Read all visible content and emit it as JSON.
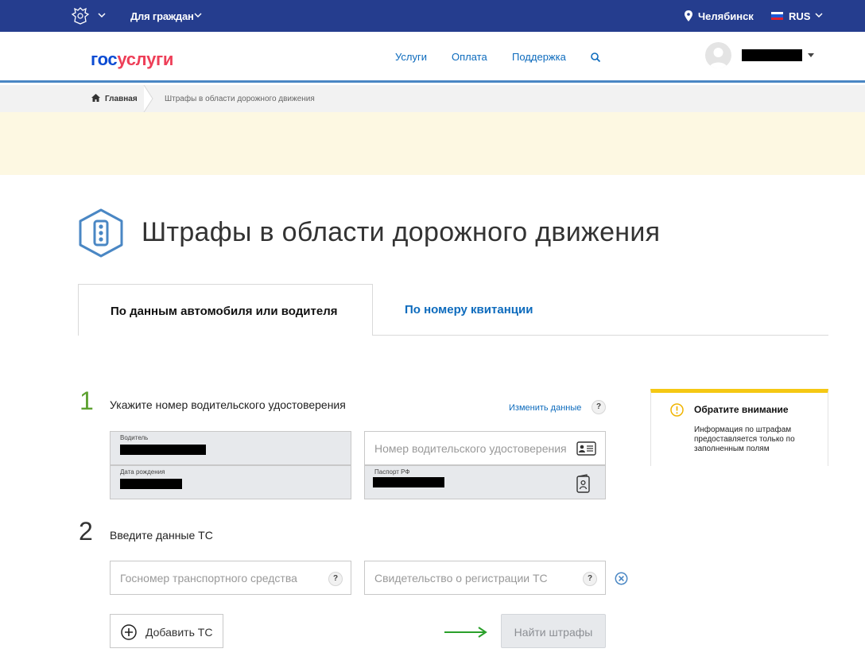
{
  "topbar": {
    "audience": "Для граждан",
    "city": "Челябинск",
    "language": "RUS"
  },
  "header": {
    "logo_part1": "гос",
    "logo_part2": "услуги",
    "nav": [
      "Услуги",
      "Оплата",
      "Поддержка"
    ]
  },
  "breadcrumb": {
    "home": "Главная",
    "current": "Штрафы в области дорожного движения"
  },
  "page": {
    "title": "Штрафы в области дорожного движения"
  },
  "tabs": [
    {
      "label": "По данным автомобиля или водителя",
      "active": true
    },
    {
      "label": "По номеру квитанции",
      "active": false
    }
  ],
  "step1": {
    "number": "1",
    "label": "Укажите номер водительского удостоверения",
    "change_link": "Изменить данные",
    "help": "?",
    "driver_caption": "Водитель",
    "birthdate_caption": "Дата рождения",
    "license_placeholder": "Номер водительского удостоверения",
    "passport_caption": "Паспорт РФ"
  },
  "step2": {
    "number": "2",
    "label": "Введите данные ТС",
    "plate_placeholder": "Госномер транспортного средства",
    "registration_placeholder": "Свидетельство о регистрации ТС",
    "help": "?"
  },
  "notice": {
    "title": "Обратите внимание",
    "text": "Информация по штрафам предоставляется только по заполненным полям"
  },
  "buttons": {
    "add_vehicle": "Добавить ТС",
    "find_fines": "Найти штрафы"
  },
  "colors": {
    "topbar": "#253d8e",
    "link": "#0d6bbd",
    "accent_yellow": "#f5c814",
    "step1_green": "#5da130",
    "arrow_green": "#2aa02a"
  }
}
